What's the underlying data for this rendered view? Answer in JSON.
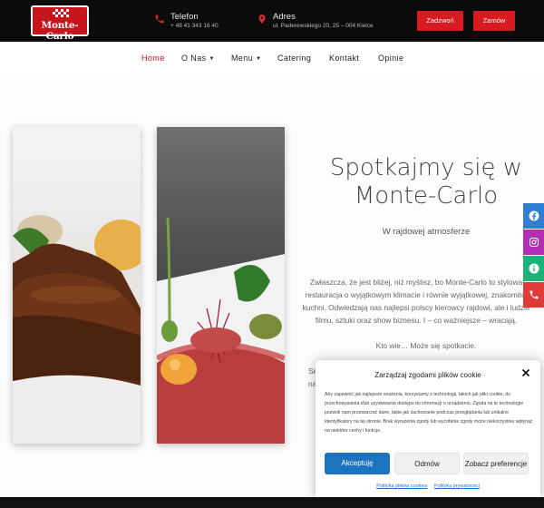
{
  "brand": {
    "logo_text": "Monte-Carlo"
  },
  "topbar": {
    "phone": {
      "label": "Telefon",
      "value": "+ 48 41 343 16 40"
    },
    "address": {
      "label": "Adres",
      "value": "ul. Paderewskiego 20, 25 – 004 Kielce"
    },
    "reserve_label": "Zadzwoń",
    "order_label": "Zamów"
  },
  "nav": {
    "items": [
      {
        "label": "Home",
        "active": true
      },
      {
        "label": "O Nas",
        "dropdown": true
      },
      {
        "label": "Menu",
        "dropdown": true
      },
      {
        "label": "Catering"
      },
      {
        "label": "Kontakt"
      },
      {
        "label": "Opinie"
      }
    ]
  },
  "hero": {
    "heading_line1": "Spotkajmy się w",
    "heading_line2": "Monte-Carlo",
    "subheading": "W rajdowej atmosferze",
    "paragraph": "Zwłaszcza, że jest bliżej, niż myślisz, bo Monte-Carlo to stylowa restauracja o wyjątkowym klimacie i równie wyjątkowej, znakomitej kuchni. Odwiedzają nas najlepsi polscy kierowcy rajdowi, ale i ludzie filmu, sztuki oraz show biznesu. I – co ważniejsze – wracają.",
    "paragraph2": "Kto wie… Może się spotkacie.",
    "cutoff_line1": "Se",
    "cutoff_line2": "na"
  },
  "social": {
    "icons": [
      "facebook-icon",
      "instagram-icon",
      "info-icon",
      "phone-icon"
    ],
    "colors": {
      "facebook": "#2f7fd0",
      "instagram": "#b02fb6",
      "info": "#1cb37a",
      "phone": "#e13a3a"
    }
  },
  "cookie": {
    "title": "Zarządzaj zgodami plików cookie",
    "body": "Aby zapewnić jak najlepsze wrażenia, korzystamy z technologii, takich jak pliki cookie, do przechowywania i/lub uzyskiwania dostępu do informacji o urządzeniu. Zgoda na te technologie pozwoli nam przetwarzać dane, takie jak zachowanie podczas przeglądania lub unikalne identyfikatory na tej stronie. Brak wyrażenia zgody lub wycofanie zgody może niekorzystnie wpłynąć na niektóre cechy i funkcje.",
    "accept_label": "Akceptuję",
    "deny_label": "Odmów",
    "prefs_label": "Zobacz preferencje",
    "link_cookie_policy": "Polityka plików cookies",
    "link_privacy": "Polityka prywatności"
  },
  "colors": {
    "accent": "#c7151c",
    "button_red": "#d81b21",
    "accept_blue": "#1e73be"
  }
}
